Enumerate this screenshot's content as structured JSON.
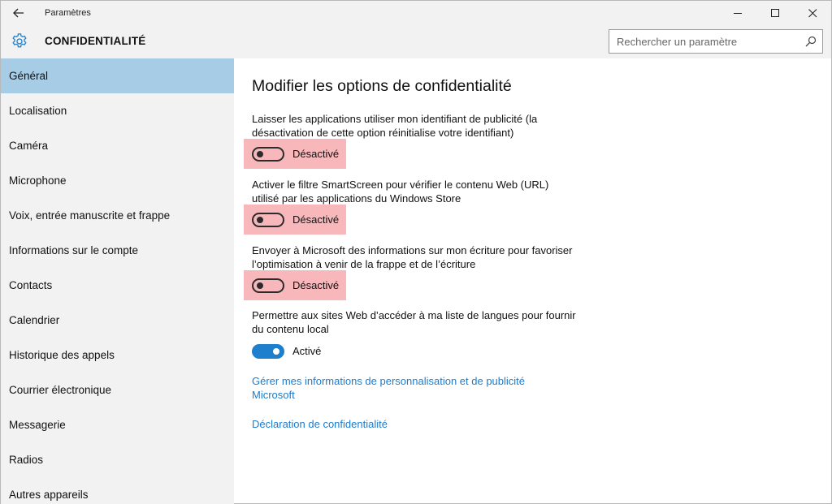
{
  "window": {
    "title": "Paramètres",
    "back_icon": "back-arrow-icon",
    "minimize_icon": "minimize-icon",
    "maximize_icon": "maximize-icon",
    "close_icon": "close-icon"
  },
  "header": {
    "section_title": "CONFIDENTIALITÉ",
    "section_icon": "gear-icon",
    "search_placeholder": "Rechercher un paramètre",
    "search_value": ""
  },
  "sidebar": {
    "items": [
      {
        "label": "Général",
        "active": true
      },
      {
        "label": "Localisation"
      },
      {
        "label": "Caméra"
      },
      {
        "label": "Microphone"
      },
      {
        "label": "Voix, entrée manuscrite et frappe"
      },
      {
        "label": "Informations sur le compte"
      },
      {
        "label": "Contacts"
      },
      {
        "label": "Calendrier"
      },
      {
        "label": "Historique des appels"
      },
      {
        "label": "Courrier électronique"
      },
      {
        "label": "Messagerie"
      },
      {
        "label": "Radios"
      },
      {
        "label": "Autres appareils"
      }
    ]
  },
  "main": {
    "title": "Modifier les options de confidentialité",
    "settings": [
      {
        "description": "Laisser les applications utiliser mon identifiant de publicité (la désactivation de cette option réinitialise votre identifiant)",
        "state": "Désactivé",
        "on": false,
        "highlighted": true
      },
      {
        "description": "Activer le filtre SmartScreen pour vérifier le contenu Web (URL) utilisé par les applications du Windows Store",
        "state": "Désactivé",
        "on": false,
        "highlighted": true
      },
      {
        "description": "Envoyer à Microsoft des informations sur mon écriture pour favoriser l’optimisation à venir de la frappe et de l’écriture",
        "state": "Désactivé",
        "on": false,
        "highlighted": true
      },
      {
        "description": "Permettre aux sites Web d’accéder à ma liste de langues pour fournir du contenu local",
        "state": "Activé",
        "on": true,
        "highlighted": false
      }
    ],
    "links": [
      {
        "label": "Gérer mes informations de personnalisation et de publicité Microsoft"
      },
      {
        "label": "Déclaration de confidentialité"
      }
    ]
  },
  "colors": {
    "accent": "#1e7fcc",
    "link": "#1c7ccf",
    "selection": "#a7cde6",
    "highlight": "#f7b7bb",
    "chrome": "#f2f2f2"
  }
}
